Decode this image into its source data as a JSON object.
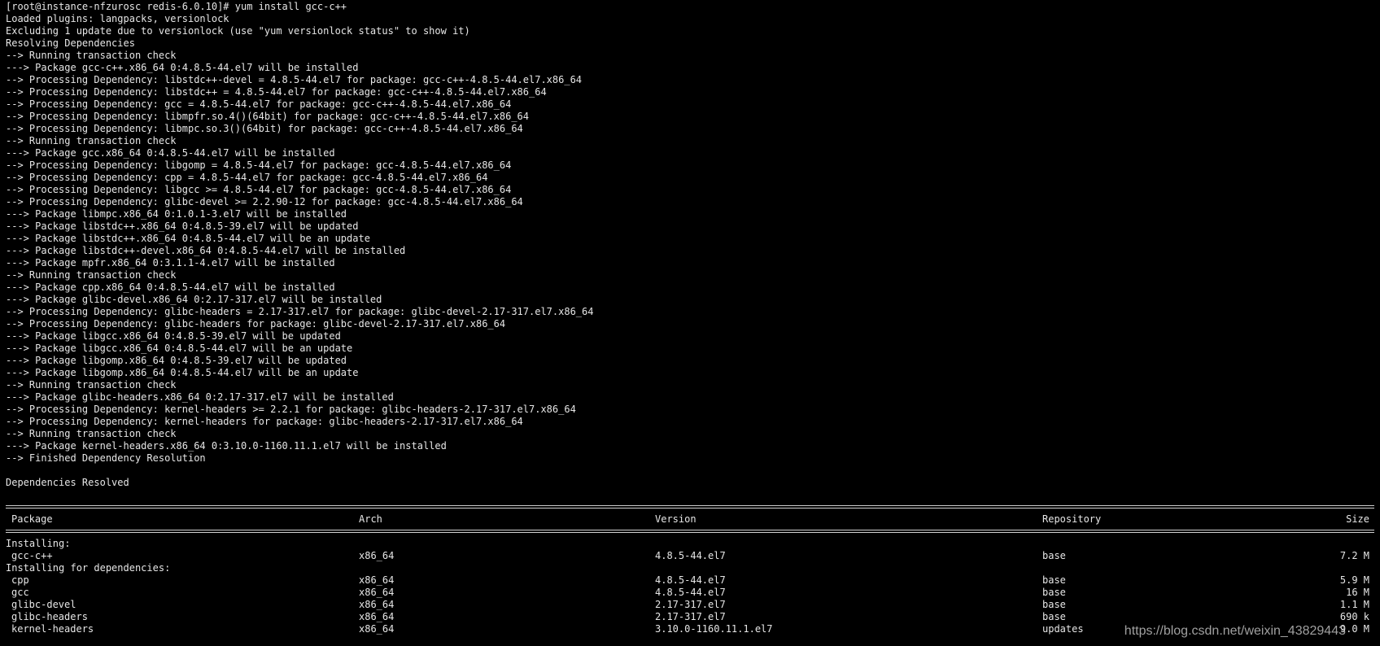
{
  "log_lines": [
    "[root@instance-nfzurosc redis-6.0.10]# yum install gcc-c++",
    "Loaded plugins: langpacks, versionlock",
    "Excluding 1 update due to versionlock (use \"yum versionlock status\" to show it)",
    "Resolving Dependencies",
    "--> Running transaction check",
    "---> Package gcc-c++.x86_64 0:4.8.5-44.el7 will be installed",
    "--> Processing Dependency: libstdc++-devel = 4.8.5-44.el7 for package: gcc-c++-4.8.5-44.el7.x86_64",
    "--> Processing Dependency: libstdc++ = 4.8.5-44.el7 for package: gcc-c++-4.8.5-44.el7.x86_64",
    "--> Processing Dependency: gcc = 4.8.5-44.el7 for package: gcc-c++-4.8.5-44.el7.x86_64",
    "--> Processing Dependency: libmpfr.so.4()(64bit) for package: gcc-c++-4.8.5-44.el7.x86_64",
    "--> Processing Dependency: libmpc.so.3()(64bit) for package: gcc-c++-4.8.5-44.el7.x86_64",
    "--> Running transaction check",
    "---> Package gcc.x86_64 0:4.8.5-44.el7 will be installed",
    "--> Processing Dependency: libgomp = 4.8.5-44.el7 for package: gcc-4.8.5-44.el7.x86_64",
    "--> Processing Dependency: cpp = 4.8.5-44.el7 for package: gcc-4.8.5-44.el7.x86_64",
    "--> Processing Dependency: libgcc >= 4.8.5-44.el7 for package: gcc-4.8.5-44.el7.x86_64",
    "--> Processing Dependency: glibc-devel >= 2.2.90-12 for package: gcc-4.8.5-44.el7.x86_64",
    "---> Package libmpc.x86_64 0:1.0.1-3.el7 will be installed",
    "---> Package libstdc++.x86_64 0:4.8.5-39.el7 will be updated",
    "---> Package libstdc++.x86_64 0:4.8.5-44.el7 will be an update",
    "---> Package libstdc++-devel.x86_64 0:4.8.5-44.el7 will be installed",
    "---> Package mpfr.x86_64 0:3.1.1-4.el7 will be installed",
    "--> Running transaction check",
    "---> Package cpp.x86_64 0:4.8.5-44.el7 will be installed",
    "---> Package glibc-devel.x86_64 0:2.17-317.el7 will be installed",
    "--> Processing Dependency: glibc-headers = 2.17-317.el7 for package: glibc-devel-2.17-317.el7.x86_64",
    "--> Processing Dependency: glibc-headers for package: glibc-devel-2.17-317.el7.x86_64",
    "---> Package libgcc.x86_64 0:4.8.5-39.el7 will be updated",
    "---> Package libgcc.x86_64 0:4.8.5-44.el7 will be an update",
    "---> Package libgomp.x86_64 0:4.8.5-39.el7 will be updated",
    "---> Package libgomp.x86_64 0:4.8.5-44.el7 will be an update",
    "--> Running transaction check",
    "---> Package glibc-headers.x86_64 0:2.17-317.el7 will be installed",
    "--> Processing Dependency: kernel-headers >= 2.2.1 for package: glibc-headers-2.17-317.el7.x86_64",
    "--> Processing Dependency: kernel-headers for package: glibc-headers-2.17-317.el7.x86_64",
    "--> Running transaction check",
    "---> Package kernel-headers.x86_64 0:3.10.0-1160.11.1.el7 will be installed",
    "--> Finished Dependency Resolution",
    "",
    "Dependencies Resolved",
    ""
  ],
  "table": {
    "headers": {
      "package": "Package",
      "arch": "Arch",
      "version": "Version",
      "repository": "Repository",
      "size": "Size"
    },
    "installing_label": "Installing:",
    "installing": [
      {
        "package": "gcc-c++",
        "arch": "x86_64",
        "version": "4.8.5-44.el7",
        "repository": "base",
        "size": "7.2 M"
      }
    ],
    "deps_label": "Installing for dependencies:",
    "deps": [
      {
        "package": "cpp",
        "arch": "x86_64",
        "version": "4.8.5-44.el7",
        "repository": "base",
        "size": "5.9 M"
      },
      {
        "package": "gcc",
        "arch": "x86_64",
        "version": "4.8.5-44.el7",
        "repository": "base",
        "size": "16 M"
      },
      {
        "package": "glibc-devel",
        "arch": "x86_64",
        "version": "2.17-317.el7",
        "repository": "base",
        "size": "1.1 M"
      },
      {
        "package": "glibc-headers",
        "arch": "x86_64",
        "version": "2.17-317.el7",
        "repository": "base",
        "size": "690 k"
      },
      {
        "package": "kernel-headers",
        "arch": "x86_64",
        "version": "3.10.0-1160.11.1.el7",
        "repository": "updates",
        "size": "9.0 M"
      }
    ]
  },
  "watermark": "https://blog.csdn.net/weixin_43829443",
  "colors": {
    "background": "#000000",
    "text": "#e6e6e6",
    "watermark": "#bdbdbd"
  }
}
